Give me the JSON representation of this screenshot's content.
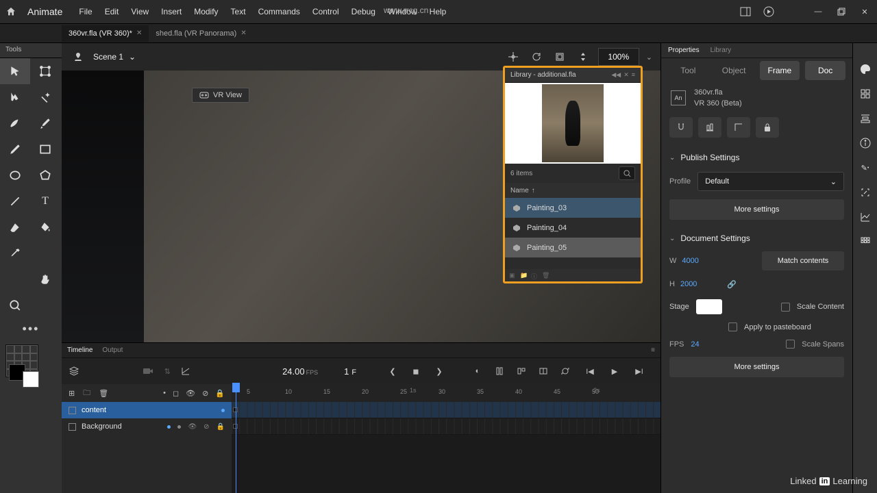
{
  "app": {
    "name": "Animate"
  },
  "menu": [
    "File",
    "Edit",
    "View",
    "Insert",
    "Modify",
    "Text",
    "Commands",
    "Control",
    "Debug",
    "Window",
    "Help"
  ],
  "watermark_url": "www.rrcg.cn",
  "tabs": [
    {
      "label": "360vr.fla (VR 360)*",
      "active": true
    },
    {
      "label": "shed.fla (VR Panorama)",
      "active": false
    }
  ],
  "tools_header": "Tools",
  "scene": {
    "label": "Scene 1"
  },
  "zoom": "100%",
  "vr_view_label": "VR View",
  "library": {
    "title": "Library - additional.fla",
    "items_count": "6 items",
    "column": "Name",
    "items": [
      "Painting_03",
      "Painting_04",
      "Painting_05"
    ],
    "selected_index": 0,
    "highlighted_index": 2
  },
  "props": {
    "tabs": [
      "Properties",
      "Library"
    ],
    "subtabs": [
      "Tool",
      "Object",
      "Frame",
      "Doc"
    ],
    "subtab_active": 3,
    "file_name": "360vr.fla",
    "file_type": "VR 360 (Beta)",
    "publish": {
      "title": "Publish Settings",
      "profile_label": "Profile",
      "profile_value": "Default",
      "more": "More settings"
    },
    "doc": {
      "title": "Document Settings",
      "w_label": "W",
      "w_value": "4000",
      "h_label": "H",
      "h_value": "2000",
      "match": "Match contents",
      "stage_label": "Stage",
      "scale_content": "Scale Content",
      "apply_pasteboard": "Apply to pasteboard",
      "scale_spans": "Scale Spans",
      "fps_label": "FPS",
      "fps_value": "24",
      "more": "More settings"
    }
  },
  "timeline": {
    "tabs": [
      "Timeline",
      "Output"
    ],
    "fps": "24.00",
    "fps_unit": "FPS",
    "frame": "1",
    "frame_unit": "F",
    "layers": [
      {
        "name": "content",
        "active": true
      },
      {
        "name": "Background",
        "active": false
      }
    ],
    "ruler_ticks": [
      5,
      10,
      15,
      20,
      25,
      30,
      35,
      40,
      45,
      50
    ],
    "time_markers": [
      "1s",
      "2s"
    ]
  },
  "footer_brand": {
    "a": "Linked",
    "b": "in",
    "c": "Learning"
  }
}
